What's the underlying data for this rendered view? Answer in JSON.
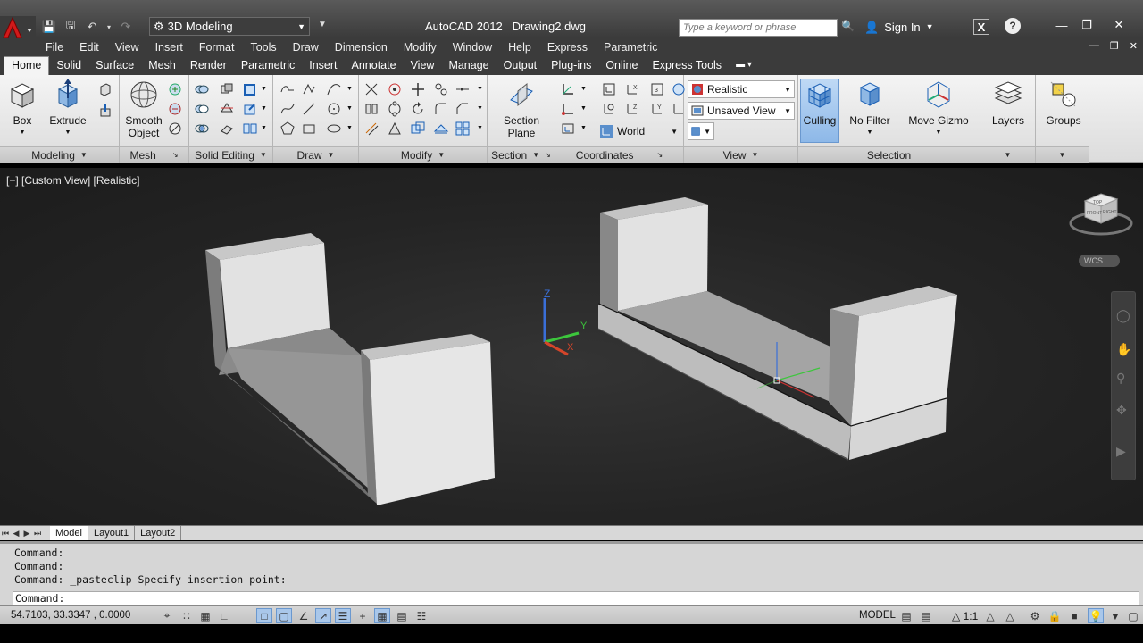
{
  "title_bar": {
    "workspace": "3D Modeling",
    "app_title": "AutoCAD 2012",
    "document_title": "Drawing2.dwg",
    "search_placeholder": "Type a keyword or phrase",
    "sign_in": "Sign In"
  },
  "menu": [
    "File",
    "Edit",
    "View",
    "Insert",
    "Format",
    "Tools",
    "Draw",
    "Dimension",
    "Modify",
    "Window",
    "Help",
    "Express",
    "Parametric"
  ],
  "ribbon_tabs": [
    "Home",
    "Solid",
    "Surface",
    "Mesh",
    "Render",
    "Parametric",
    "Insert",
    "Annotate",
    "View",
    "Manage",
    "Output",
    "Plug-ins",
    "Online",
    "Express Tools"
  ],
  "ribbon": {
    "box": "Box",
    "extrude": "Extrude",
    "smooth_object_1": "Smooth",
    "smooth_object_2": "Object",
    "section_plane_1": "Section",
    "section_plane_2": "Plane",
    "visual_style": "Realistic",
    "view_name": "Unsaved View",
    "ucs": "World",
    "culling": "Culling",
    "no_filter": "No Filter",
    "move_gizmo": "Move Gizmo",
    "layers": "Layers",
    "groups": "Groups",
    "panels": {
      "modeling": "Modeling",
      "mesh": "Mesh",
      "solid_editing": "Solid Editing",
      "draw": "Draw",
      "modify": "Modify",
      "section": "Section",
      "coordinates": "Coordinates",
      "view": "View",
      "selection": "Selection"
    }
  },
  "viewport": {
    "label": "[−] [Custom View] [Realistic]",
    "wcs": "WCS",
    "viewcube_top": "TOP",
    "viewcube_right": "RIGHT",
    "viewcube_front": "FRONT"
  },
  "layout_tabs": [
    "Model",
    "Layout1",
    "Layout2"
  ],
  "command": {
    "history": [
      "Command:",
      "Command:",
      "Command: _pasteclip Specify insertion point:"
    ],
    "prompt": "Command:"
  },
  "status": {
    "coordinates": "54.7103,  33.3347 , 0.0000",
    "space": "MODEL",
    "annotation_scale": "1:1"
  },
  "colors": {
    "viewport_bg": "#262626",
    "solid_face_light": "#d9d9d9",
    "solid_face_dark": "#8f8f8f",
    "active_toggle": "#a9c7ea"
  }
}
